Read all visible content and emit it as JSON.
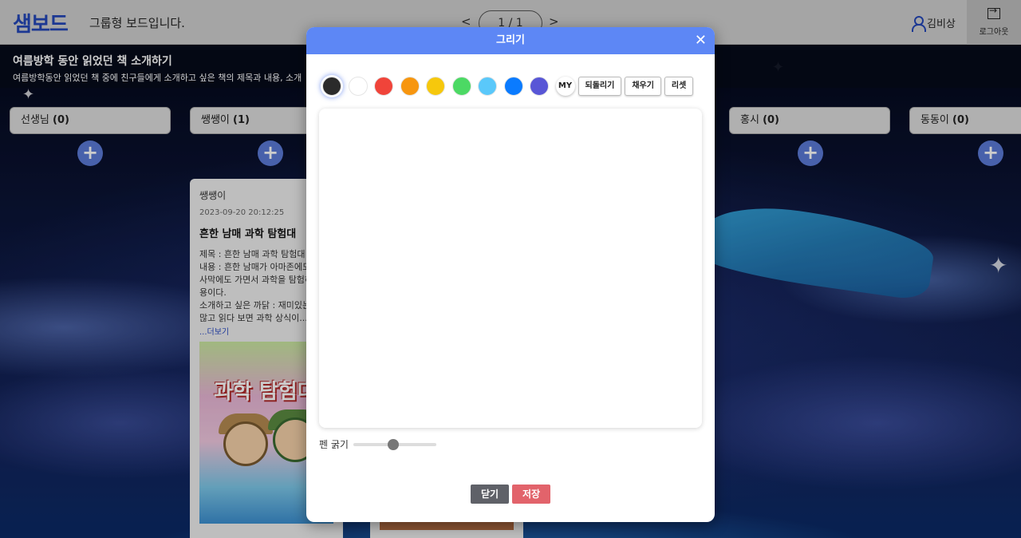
{
  "header": {
    "logo": "샘보드",
    "subtitle": "그룹형 보드입니다.",
    "pager": "1 / 1",
    "pager_prev": "<",
    "pager_next": ">",
    "user_name": "김비상",
    "logout_label": "로그아웃"
  },
  "board": {
    "title": "여름방학 동안 읽었던 책 소개하기",
    "description": "여름방학동안 읽었던 책 중에 친구들에게 소개하고 싶은 책의 제목과 내용, 소개"
  },
  "columns": [
    {
      "label": "선생님",
      "count": "(0)"
    },
    {
      "label": "쌩쌩이",
      "count": "(1)"
    },
    {
      "label": "홍시",
      "count": "(0)"
    },
    {
      "label": "동동이",
      "count": "(0)"
    }
  ],
  "add_symbol": "+",
  "post": {
    "author": "쌩쌩이",
    "date": "2023-09-20 20:12:25",
    "title": "흔한 남매 과학 탐험대",
    "body_lines": [
      "제목 : 흔한 남매 과학 탐험대",
      "내용 : 흔한 남매가 아마존에도",
      "사막에도 가면서 과학을 탐험하",
      "용이다.",
      "소개하고 싶은 까닭 : 재미있는",
      "많고 읽다 보면 과학 상식이..."
    ],
    "more": "...더보기",
    "cover_text": "과학 탐험대"
  },
  "modal": {
    "title": "그리기",
    "close_symbol": "✕",
    "colors": [
      "#2b2b2b",
      "#ffffff",
      "#f0443a",
      "#f7960f",
      "#f6c80c",
      "#4cd964",
      "#5ac8fa",
      "#0a7bff",
      "#5856d6"
    ],
    "selected_color_index": 0,
    "my_label": "MY",
    "undo_label": "되돌리기",
    "fill_label": "채우기",
    "reset_label": "리셋",
    "pen_label": "펜 굵기",
    "pen_thickness_fraction": 0.48,
    "close_label": "닫기",
    "save_label": "저장"
  }
}
